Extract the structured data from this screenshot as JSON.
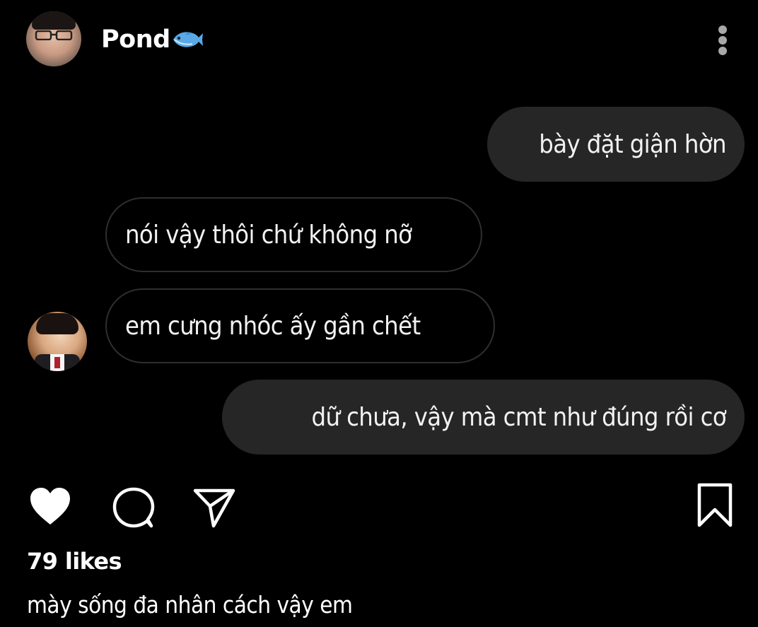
{
  "header": {
    "username": "Pond",
    "badge_icon": "fish-icon",
    "more_icon": "more-vertical-icon"
  },
  "messages": [
    {
      "side": "sent",
      "text": "bày đặt giận hờn"
    },
    {
      "side": "received",
      "text": "nói vậy thôi chứ không nỡ"
    },
    {
      "side": "received",
      "text": "em cưng nhóc ấy gần chết"
    },
    {
      "side": "sent",
      "text": "dữ chưa, vậy mà cmt như đúng rồi cơ"
    }
  ],
  "actions": {
    "like_icon": "heart-icon",
    "comment_icon": "comment-icon",
    "share_icon": "send-icon",
    "save_icon": "bookmark-icon"
  },
  "post": {
    "likes": "79 likes",
    "caption": "mày sống đa nhân cách vậy em"
  },
  "colors": {
    "background": "#000000",
    "sent_bubble": "#262626",
    "received_border": "#2e2e2e",
    "text": "#ffffff"
  }
}
